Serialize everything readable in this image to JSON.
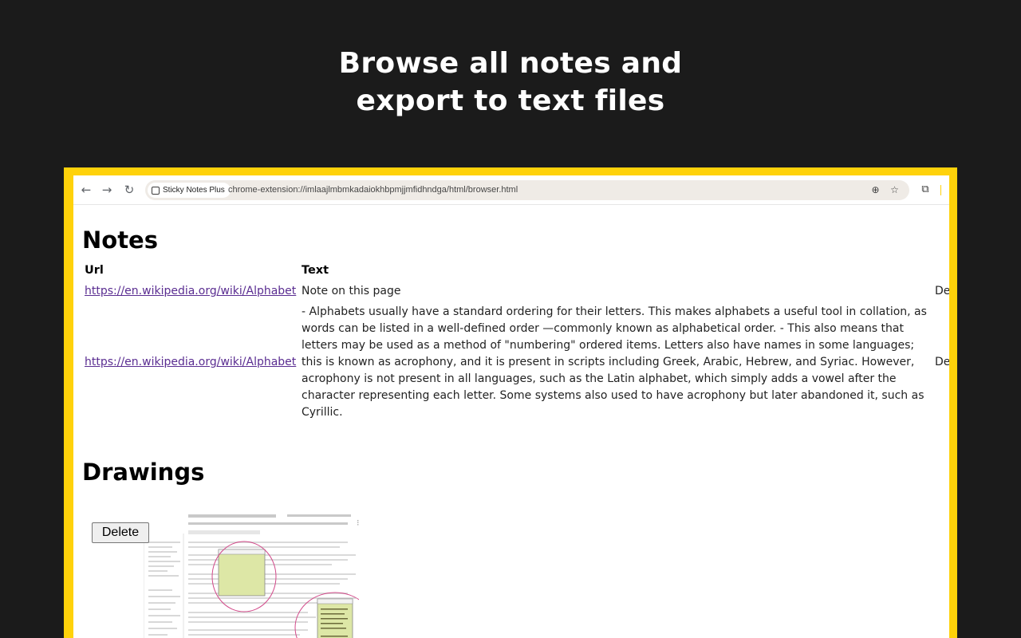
{
  "headline": {
    "line1": "Browse all notes and",
    "line2": "export to text files"
  },
  "browser": {
    "tab_chip_label": "Sticky Notes Plus",
    "url": "chrome-extension://imlaajlmbmkadaiokhbpmjjmfidhndga/html/browser.html",
    "icons": [
      "back-icon",
      "forward-icon",
      "reload-icon",
      "zoom-icon",
      "star-icon",
      "extensions-icon"
    ]
  },
  "page": {
    "notes_title": "Notes",
    "columns": {
      "url": "Url",
      "text": "Text"
    },
    "rows": [
      {
        "url": "https://en.wikipedia.org/wiki/Alphabet",
        "text": "Note on this page",
        "extra": "De"
      },
      {
        "url": "https://en.wikipedia.org/wiki/Alphabet",
        "text": "- Alphabets usually have a standard ordering for their letters. This makes alphabets a useful tool in collation, as words can be listed in a well-defined order —commonly known as alphabetical order. - This also means that letters may be used as a method of \"numbering\" ordered items. Letters also have names in some languages; this is known as acrophony, and it is present in scripts including Greek, Arabic, Hebrew, and Syriac. However, acrophony is not present in all languages, such as the Latin alphabet, which simply adds a vowel after the character representing each letter. Some systems also used to have acrophony but later abandoned it, such as Cyrillic.",
        "extra": "De"
      }
    ],
    "drawings_title": "Drawings",
    "delete_label": "Delete"
  },
  "colors": {
    "background": "#1b1b1b",
    "frame": "#ffd20a",
    "link": "#5a2d91"
  }
}
